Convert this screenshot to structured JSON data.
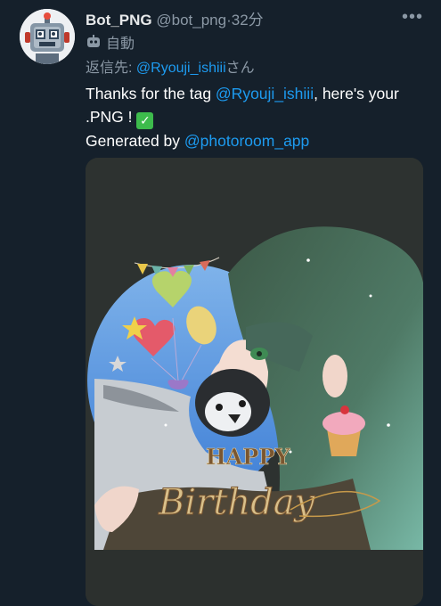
{
  "tweet": {
    "display_name": "Bot_PNG",
    "handle": "@bot_png",
    "separator": "·",
    "time": "32分",
    "automated_label": "自動",
    "reply_prefix": "返信先: ",
    "reply_mention": "@Ryouji_ishiii",
    "reply_suffix": "さん",
    "text_part1": "Thanks for the tag ",
    "text_mention": "@Ryouji_ishiii",
    "text_part2": ", here's your .PNG ! ",
    "check_glyph": "✓",
    "text_line2_prefix": "Generated by ",
    "text_line2_mention": "@photoroom_app",
    "more_glyph": "•••"
  },
  "image": {
    "happy_text": "HAPPY",
    "birthday_text": "Birthday"
  },
  "colors": {
    "background": "#15202b",
    "link": "#1d9bf0",
    "muted": "#8b98a5",
    "check_green": "#3dbb4c"
  }
}
